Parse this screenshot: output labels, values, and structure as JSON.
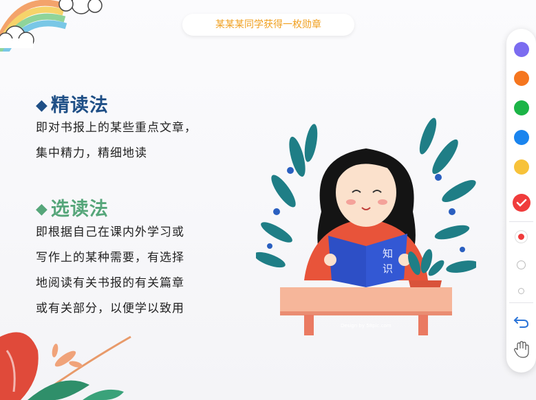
{
  "banner": {
    "text": "某某某同学获得一枚勋章"
  },
  "sections": [
    {
      "title": "精读法",
      "body": "即对书报上的某些重点文章，\n集中精力，精细地读"
    },
    {
      "title": "选读法",
      "body": "即根据自己在课内外学习或\n写作上的某种需要，有选择\n地阅读有关书报的有关篇章\n或有关部分，以便学以致用"
    }
  ],
  "illustration": {
    "book_text": "知识",
    "credit": "Design by 58pic.com"
  },
  "toolbar": {
    "colors": [
      "#7b6cf0",
      "#f5761f",
      "#1cb447",
      "#1a84ee",
      "#f7c23a",
      "#f03c3c"
    ],
    "selected_color_index": 5,
    "selected_brush_size": "large",
    "icons": [
      "check-icon",
      "undo-icon",
      "hand-icon"
    ]
  }
}
